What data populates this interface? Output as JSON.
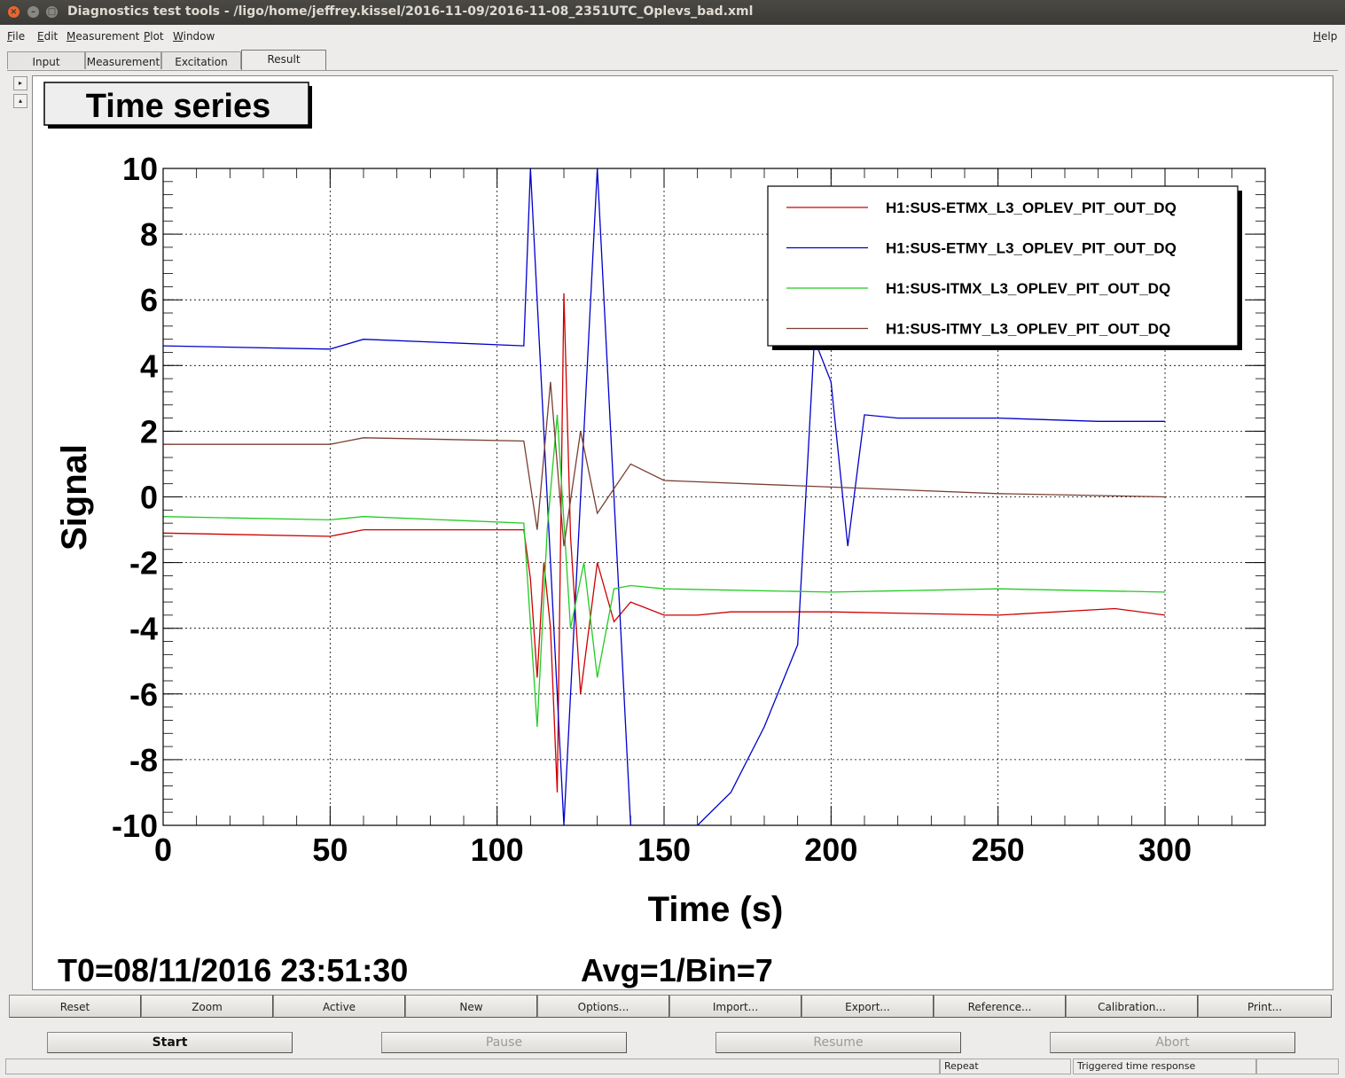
{
  "window": {
    "title": "Diagnostics test tools - /ligo/home/jeffrey.kissel/2016-11-09/2016-11-08_2351UTC_Oplevs_bad.xml",
    "close_glyph": "×",
    "min_glyph": "–",
    "max_glyph": "□"
  },
  "menu": {
    "file": "File",
    "edit": "Edit",
    "measurement": "Measurement",
    "plot": "Plot",
    "window": "Window",
    "help": "Help"
  },
  "tabs": [
    "Input",
    "Measurement",
    "Excitation",
    "Result"
  ],
  "active_tab": "Result",
  "side_buttons": {
    "right_arrow": "▸",
    "up_arrow": "▴"
  },
  "plot": {
    "pad_title": "Time series",
    "t0_label": "T0=08/11/2016 23:51:30",
    "avg_label": "Avg=1/Bin=7"
  },
  "chart_data": {
    "type": "line",
    "xlabel": "Time (s)",
    "ylabel": "Signal",
    "xlim": [
      0,
      330
    ],
    "ylim": [
      -10,
      10
    ],
    "x_ticks": [
      "0",
      "50",
      "100",
      "150",
      "200",
      "250",
      "300"
    ],
    "y_ticks": [
      "10",
      "8",
      "6",
      "4",
      "2",
      "0",
      "-2",
      "-4",
      "-6",
      "-8",
      "-10"
    ],
    "grid": true,
    "legend_position": "top-right",
    "series": [
      {
        "name": "H1:SUS-ETMX_L3_OPLEV_PIT_OUT_DQ",
        "color": "#cc0000",
        "x": [
          0,
          50,
          60,
          108,
          110,
          112,
          114,
          116,
          118,
          120,
          122,
          125,
          130,
          135,
          140,
          150,
          160,
          170,
          200,
          250,
          285,
          300
        ],
        "y": [
          -1.1,
          -1.2,
          -1.0,
          -1.0,
          -2.5,
          -5.5,
          -2.0,
          -4.0,
          -9.0,
          6.2,
          -1.2,
          -6.0,
          -2.0,
          -3.8,
          -3.2,
          -3.6,
          -3.6,
          -3.5,
          -3.5,
          -3.6,
          -3.4,
          -3.6
        ]
      },
      {
        "name": "H1:SUS-ETMY_L3_OPLEV_PIT_OUT_DQ",
        "color": "#0000cc",
        "x": [
          0,
          50,
          60,
          108,
          110,
          120,
          130,
          140,
          150,
          160,
          170,
          180,
          190,
          195,
          200,
          205,
          210,
          220,
          250,
          280,
          300
        ],
        "y": [
          4.6,
          4.5,
          4.8,
          4.6,
          10,
          -10,
          10,
          -10,
          -10,
          -10,
          -9.0,
          -7.0,
          -4.5,
          4.8,
          3.5,
          -1.5,
          2.5,
          2.4,
          2.4,
          2.3,
          2.3
        ]
      },
      {
        "name": "H1:SUS-ITMX_L3_OPLEV_PIT_OUT_DQ",
        "color": "#22cc22",
        "x": [
          0,
          50,
          60,
          108,
          112,
          115,
          118,
          122,
          126,
          130,
          135,
          140,
          150,
          200,
          250,
          300
        ],
        "y": [
          -0.6,
          -0.7,
          -0.6,
          -0.8,
          -7.0,
          -1.0,
          2.5,
          -4.0,
          -2.0,
          -5.5,
          -2.8,
          -2.7,
          -2.8,
          -2.9,
          -2.8,
          -2.9
        ]
      },
      {
        "name": "H1:SUS-ITMY_L3_OPLEV_PIT_OUT_DQ",
        "color": "#7a3f33",
        "x": [
          0,
          50,
          60,
          108,
          112,
          116,
          120,
          125,
          130,
          140,
          150,
          200,
          250,
          300
        ],
        "y": [
          1.6,
          1.6,
          1.8,
          1.7,
          -1.0,
          3.5,
          -1.5,
          2.0,
          -0.5,
          1.0,
          0.5,
          0.3,
          0.1,
          0.0
        ]
      }
    ]
  },
  "bottom_buttons": [
    "Reset",
    "Zoom",
    "Active",
    "New",
    "Options...",
    "Import...",
    "Export...",
    "Reference...",
    "Calibration...",
    "Print..."
  ],
  "controls": {
    "start": "Start",
    "pause": "Pause",
    "resume": "Resume",
    "abort": "Abort"
  },
  "status": {
    "mode": "Repeat",
    "type": "Triggered time response"
  }
}
